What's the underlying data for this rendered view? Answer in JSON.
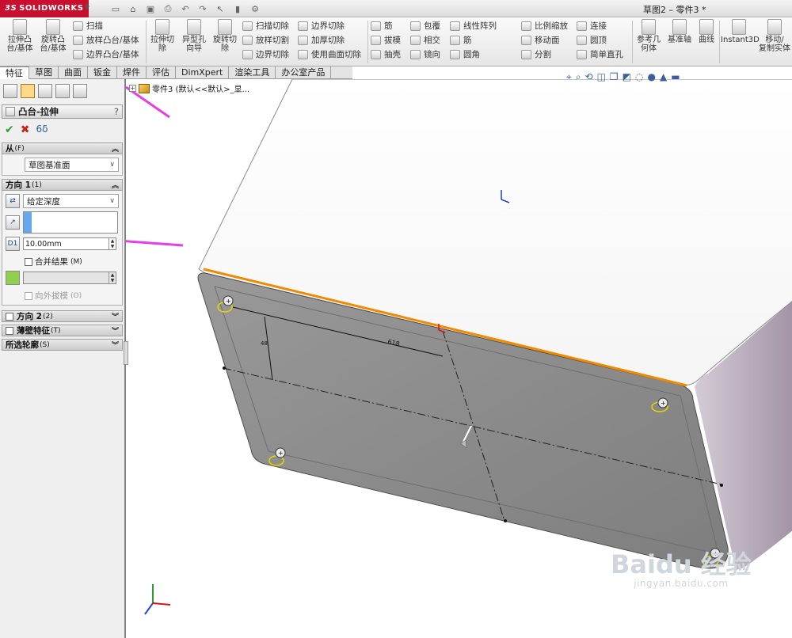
{
  "app": {
    "brand": "SOLIDWORKS",
    "brand_prefix": "3S",
    "title": "草图2 – 零件3 *",
    "quick_access": [
      "new-icon",
      "open-icon",
      "save-icon",
      "print-icon",
      "undo-icon",
      "redo-icon",
      "select-icon",
      "rebuild-icon",
      "options-icon"
    ]
  },
  "commands": {
    "big": [
      {
        "id": "extrude-boss",
        "label1": "拉伸凸",
        "label2": "台/基体"
      },
      {
        "id": "revolve-boss",
        "label1": "旋转凸",
        "label2": "台/基体"
      },
      {
        "id": "extrude-cut",
        "label1": "拉伸切",
        "label2": "除"
      },
      {
        "id": "hole-wizard",
        "label1": "异型孔",
        "label2": "向导"
      },
      {
        "id": "revolve-cut",
        "label1": "旋转切",
        "label2": "除"
      }
    ],
    "small_col1": [
      "扫描",
      "放样凸台/基体",
      "边界凸台/基体"
    ],
    "small_col2": [
      "扫描切除",
      "放样切割",
      "边界切除"
    ],
    "small_col3": [
      "边界切除",
      "加厚切除",
      "使用曲面切除"
    ],
    "small_col4": [
      "筋",
      "拔模",
      "抽壳"
    ],
    "small_col5": [
      "包覆",
      "相交",
      "镜向"
    ],
    "small_col6": [
      "线性阵列",
      "筋",
      "圆角"
    ],
    "small_col7": [
      "比例缩放",
      "移动面",
      "分割"
    ],
    "small_col8": [
      "连接",
      "圆顶",
      "简单直孔"
    ],
    "right_big": [
      {
        "id": "ref-geometry",
        "label1": "参考几",
        "label2": "何体"
      },
      {
        "id": "datum-axis",
        "label1": "基准轴",
        "label2": ""
      },
      {
        "id": "curves",
        "label1": "曲线",
        "label2": ""
      },
      {
        "id": "instant3d",
        "label1": "Instant3D",
        "label2": ""
      },
      {
        "id": "move-copy",
        "label1": "移动/",
        "label2": "复制实体"
      }
    ]
  },
  "tabs": [
    "特征",
    "草图",
    "曲面",
    "钣金",
    "焊件",
    "评估",
    "DimXpert",
    "渲染工具",
    "办公室产品"
  ],
  "tree": {
    "item": "零件3 (默认<<默认>_显..."
  },
  "pm": {
    "title": "凸台-拉伸",
    "help": "?",
    "from": {
      "label": "从",
      "sub": "(F)",
      "value": "草图基准面"
    },
    "dir1": {
      "label": "方向 1",
      "sub": "(1)",
      "end": "给定深度",
      "depth": "10.00mm",
      "merge": "合并结果",
      "merge_sub": "(M)",
      "draft": "向外拔模",
      "draft_sub": "(O)"
    },
    "dir2": {
      "label": "方向 2",
      "sub": "(2)"
    },
    "thin": {
      "label": "薄壁特征",
      "sub": "(T)"
    },
    "contours": {
      "label": "所选轮廓",
      "sub": "(S)"
    }
  },
  "dims": {
    "d1": "618",
    "d2": "48"
  },
  "watermark": {
    "big": "Baidu 经验",
    "url": "jingyan.baidu.com"
  },
  "colors": {
    "brand": "#c8102e",
    "edge_highlight": "#f08a00",
    "arrow": "#e63ee6",
    "face_dark": "#8c8c8c",
    "face_side": "#a79aa9"
  }
}
